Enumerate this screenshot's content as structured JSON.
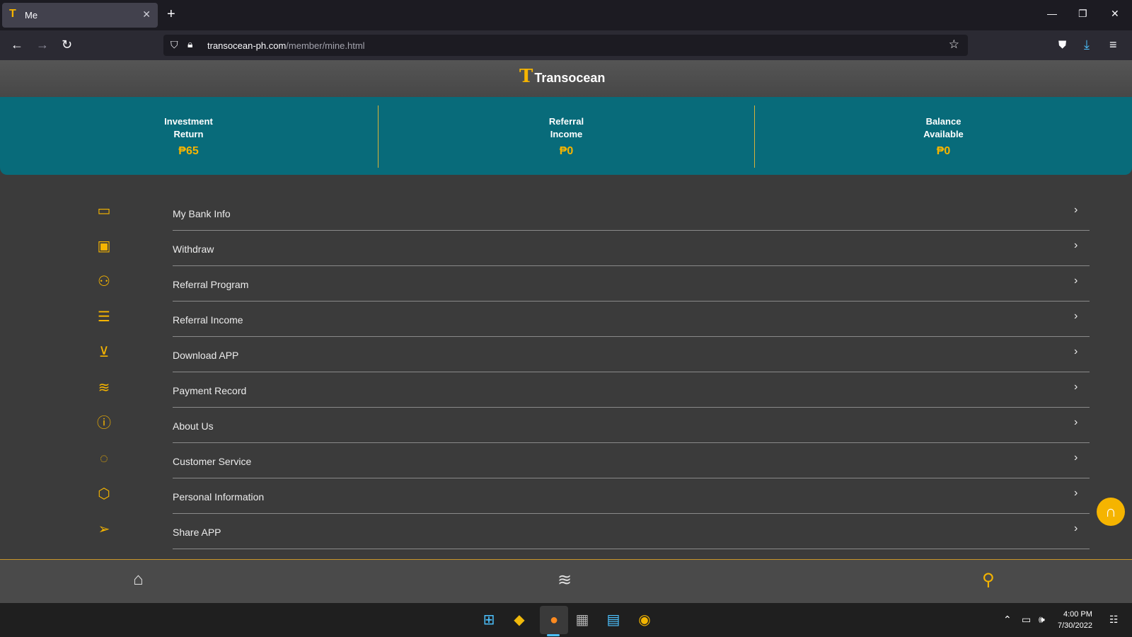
{
  "browser": {
    "tab_title": "Me",
    "tab_favicon": "T",
    "url_host": "transocean-ph.com",
    "url_path": "/member/mine.html"
  },
  "header": {
    "brand": "Transocean"
  },
  "stats": [
    {
      "label": "Investment Return",
      "value": "₱65"
    },
    {
      "label": "Referral Income",
      "value": "₱0"
    },
    {
      "label": "Balance Available",
      "value": "₱0"
    }
  ],
  "menu": [
    {
      "label": "My Bank Info",
      "icon": "card-icon"
    },
    {
      "label": "Withdraw",
      "icon": "wallet-icon"
    },
    {
      "label": "Referral Program",
      "icon": "people-icon"
    },
    {
      "label": "Referral Income",
      "icon": "inbox-icon"
    },
    {
      "label": "Download APP",
      "icon": "download-icon"
    },
    {
      "label": "Payment Record",
      "icon": "layers-icon"
    },
    {
      "label": "About Us",
      "icon": "info-icon"
    },
    {
      "label": "Customer Service",
      "icon": "chat-icon"
    },
    {
      "label": "Personal Information",
      "icon": "settings-icon"
    },
    {
      "label": "Share APP",
      "icon": "send-icon"
    }
  ],
  "colors": {
    "accent": "#f5b400",
    "teal": "#086b7a"
  },
  "taskbar": {
    "time": "4:00 PM",
    "date": "7/30/2022"
  }
}
